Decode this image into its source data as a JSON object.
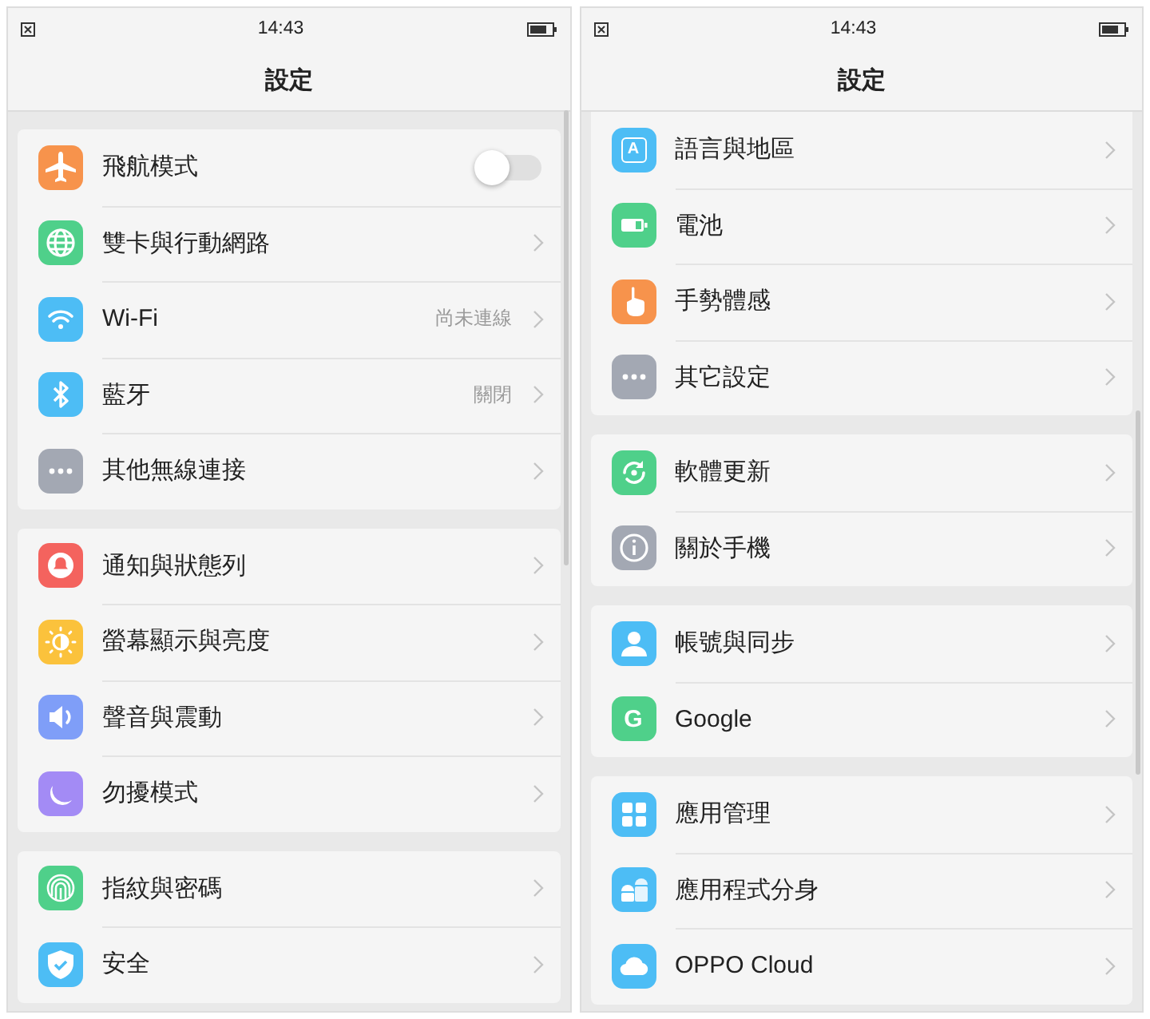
{
  "screens": [
    {
      "status_bar": {
        "time": "14:43"
      },
      "title": "設定",
      "groups": [
        {
          "items": [
            {
              "kind": "toggle",
              "color": "#f7934c",
              "label": "飛航模式",
              "on": false
            },
            {
              "kind": "link",
              "color": "#4fd08a",
              "label": "雙卡與行動網路"
            },
            {
              "kind": "link",
              "color": "#4dbdf5",
              "label": "Wi-Fi",
              "value": "尚未連線"
            },
            {
              "kind": "link",
              "color": "#4dbdf5",
              "label": "藍牙",
              "value": "關閉"
            },
            {
              "kind": "link",
              "color": "#a3a8b3",
              "label": "其他無線連接"
            }
          ]
        },
        {
          "items": [
            {
              "kind": "link",
              "color": "#f4635e",
              "label": "通知與狀態列"
            },
            {
              "kind": "link",
              "color": "#fbc23c",
              "label": "螢幕顯示與亮度"
            },
            {
              "kind": "link",
              "color": "#7f9ef8",
              "label": "聲音與震動"
            },
            {
              "kind": "link",
              "color": "#a38bf5",
              "label": "勿擾模式"
            }
          ]
        },
        {
          "items": [
            {
              "kind": "link",
              "color": "#4fd08a",
              "label": "指紋與密碼"
            },
            {
              "kind": "link",
              "color": "#4dbdf5",
              "label": "安全"
            }
          ]
        }
      ]
    },
    {
      "status_bar": {
        "time": "14:43"
      },
      "title": "設定",
      "groups": [
        {
          "items": [
            {
              "kind": "link",
              "icon_text": "A",
              "color": "#4dbdf5",
              "label": "語言與地區"
            },
            {
              "kind": "link",
              "color": "#4fd08a",
              "label": "電池"
            },
            {
              "kind": "link",
              "color": "#f7934c",
              "label": "手勢體感"
            },
            {
              "kind": "link",
              "color": "#a3a8b3",
              "label": "其它設定"
            }
          ]
        },
        {
          "items": [
            {
              "kind": "link",
              "color": "#4fd08a",
              "label": "軟體更新"
            },
            {
              "kind": "link",
              "color": "#a3a8b3",
              "label": "關於手機"
            }
          ]
        },
        {
          "items": [
            {
              "kind": "link",
              "color": "#4dbdf5",
              "label": "帳號與同步"
            },
            {
              "kind": "link",
              "icon_text": "G",
              "color": "#4fd08a",
              "label": "Google"
            }
          ]
        },
        {
          "items": [
            {
              "kind": "link",
              "color": "#4dbdf5",
              "label": "應用管理"
            },
            {
              "kind": "link",
              "color": "#4dbdf5",
              "label": "應用程式分身"
            },
            {
              "kind": "link",
              "color": "#4dbdf5",
              "label": "OPPO Cloud"
            }
          ]
        }
      ]
    }
  ]
}
